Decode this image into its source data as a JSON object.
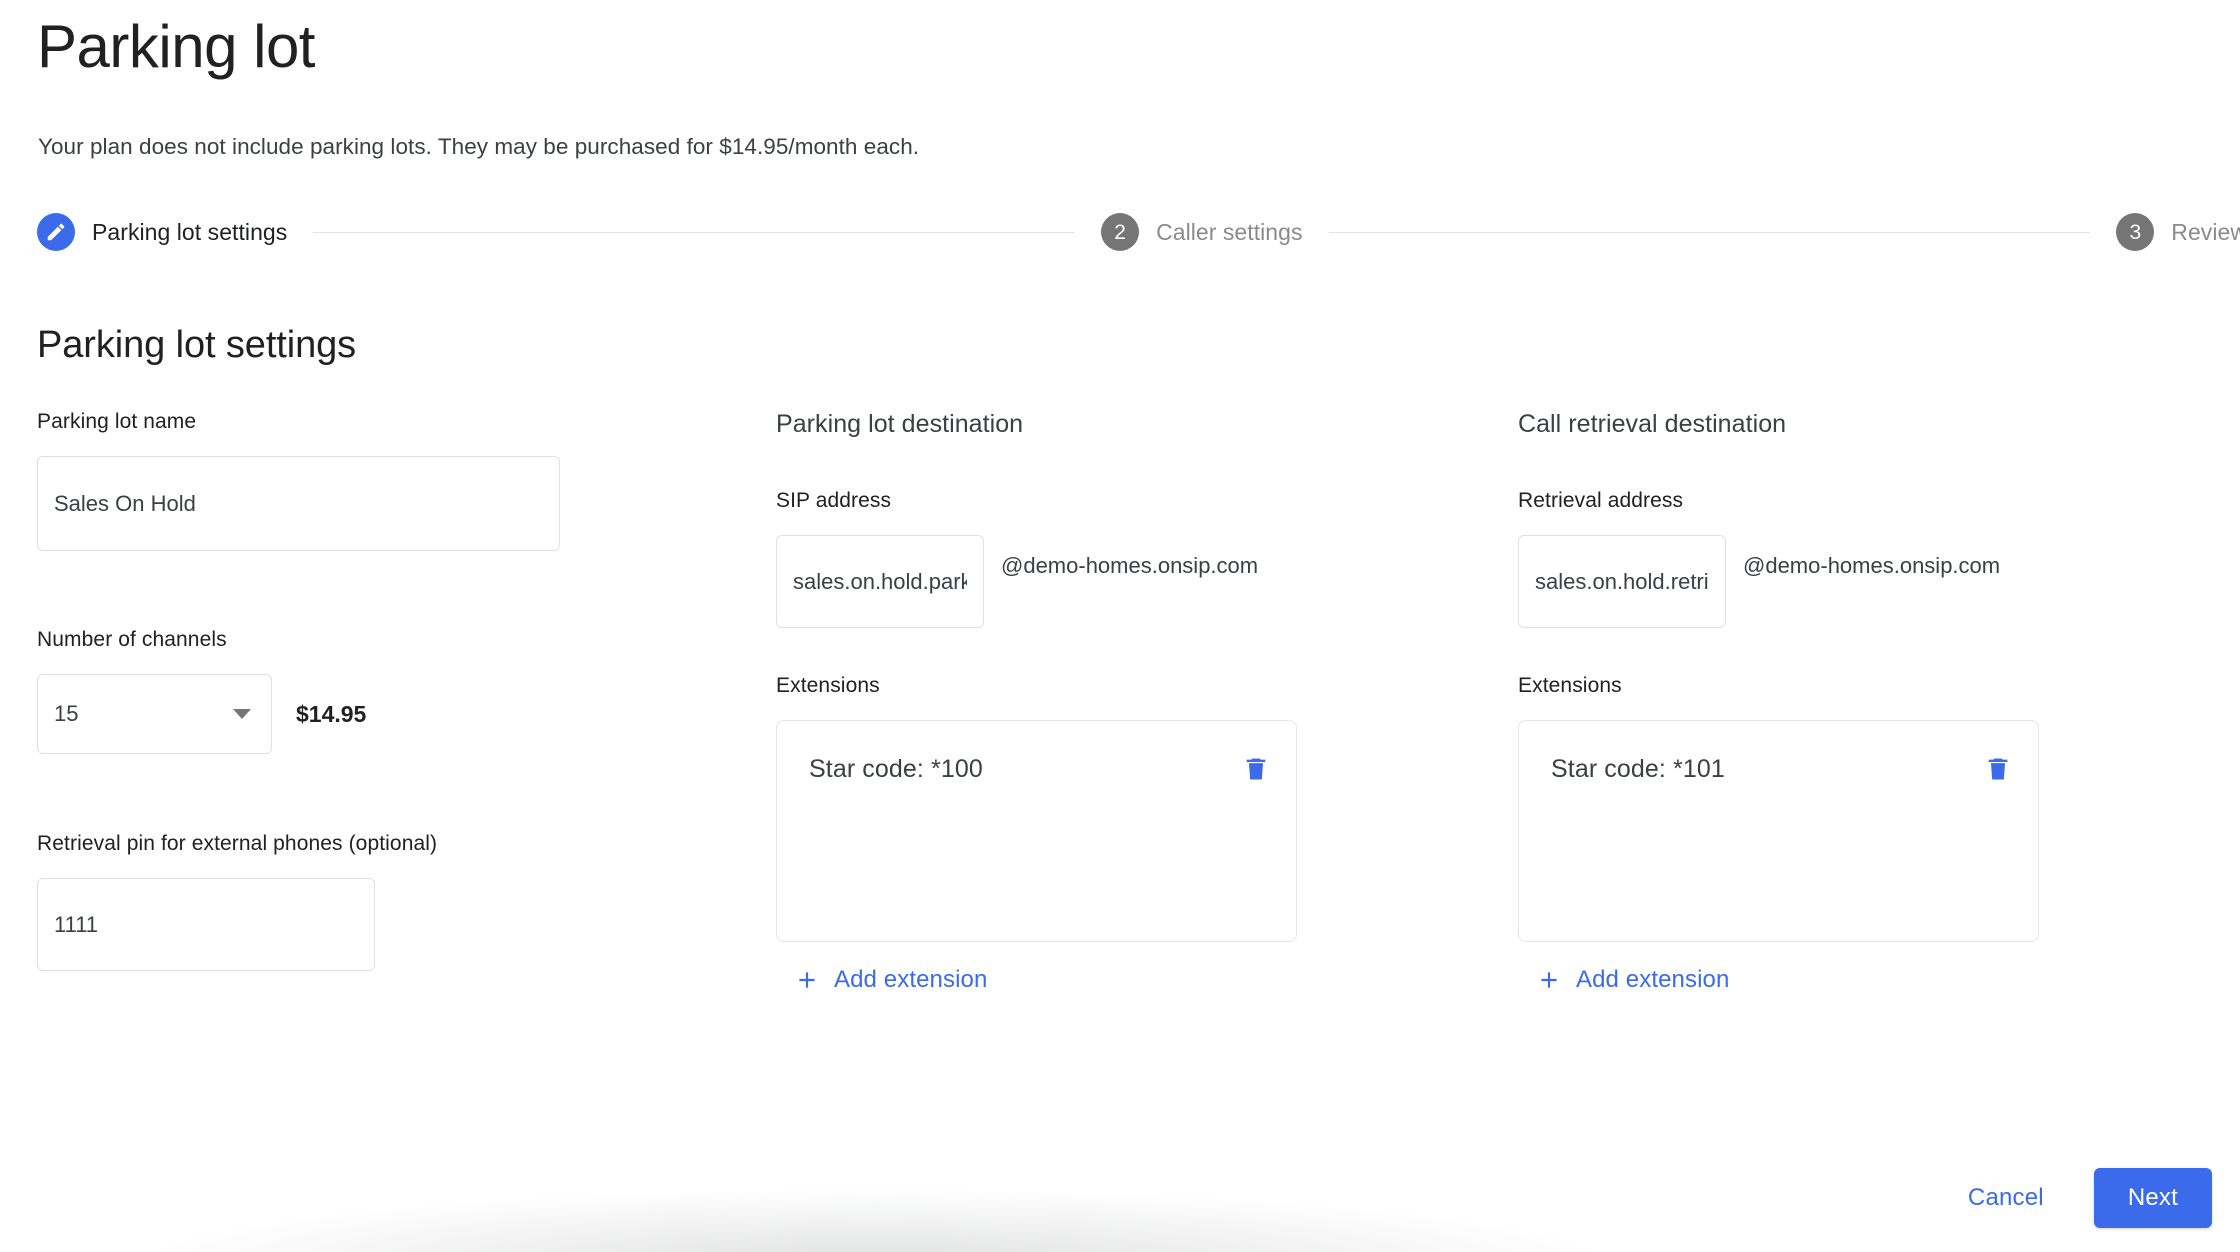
{
  "header": {
    "title": "Parking lot",
    "subtitle": "Your plan does not include parking lots. They may be purchased for $14.95/month each."
  },
  "stepper": {
    "steps": [
      {
        "marker": "edit-icon",
        "label": "Parking lot settings",
        "state": "active"
      },
      {
        "marker": "2",
        "label": "Caller settings",
        "state": "inactive"
      },
      {
        "marker": "3",
        "label": "Review",
        "state": "inactive"
      }
    ]
  },
  "section": {
    "title": "Parking lot settings"
  },
  "settings": {
    "name_label": "Parking lot name",
    "name_value": "Sales On Hold",
    "name_placeholder": "Parking lot name",
    "channels_label": "Number of channels",
    "channels_value": "15",
    "channels_price": "$14.95",
    "pin_label": "Retrieval pin for external phones (optional)",
    "pin_value": "1111",
    "pin_placeholder": "Retrieval pin"
  },
  "parking_destination": {
    "heading": "Parking lot destination",
    "address_label": "SIP address",
    "address_value": "sales.on.hold.park",
    "address_placeholder": "SIP address",
    "domain": "@demo-homes.onsip.com",
    "extensions_label": "Extensions",
    "extensions": [
      {
        "text": "Star code: *100"
      }
    ],
    "add_extension_label": "Add extension"
  },
  "retrieval_destination": {
    "heading": "Call retrieval destination",
    "address_label": "Retrieval address",
    "address_value": "sales.on.hold.retrieve",
    "address_placeholder": "Retrieval address",
    "domain": "@demo-homes.onsip.com",
    "extensions_label": "Extensions",
    "extensions": [
      {
        "text": "Star code: *101"
      }
    ],
    "add_extension_label": "Add extension"
  },
  "footer": {
    "cancel_label": "Cancel",
    "next_label": "Next"
  },
  "colors": {
    "accent": "#3b6bea",
    "inactive_step": "#757575",
    "text": "#202124",
    "muted_text": "#8b8b8b",
    "border": "#e0e0e0"
  }
}
